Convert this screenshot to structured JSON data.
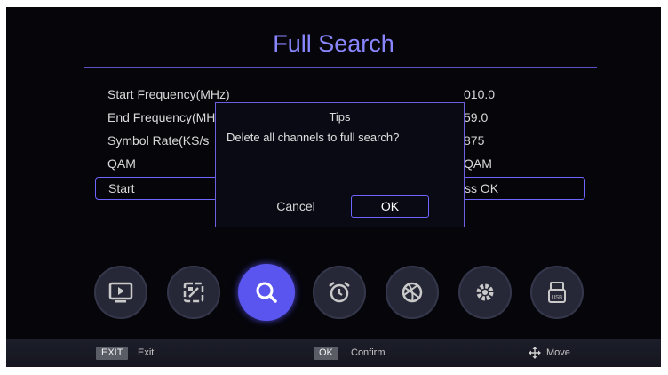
{
  "title": "Full Search",
  "rows": [
    {
      "label": "Start Frequency(MHz)",
      "value": "010.0"
    },
    {
      "label": "End Frequency(MH",
      "value": "59.0"
    },
    {
      "label": "Symbol Rate(KS/s",
      "value": "875"
    },
    {
      "label": "QAM",
      "value": "QAM"
    },
    {
      "label": "Start",
      "value": "ss OK"
    }
  ],
  "dialog": {
    "title": "Tips",
    "message": "Delete all channels to full search?",
    "cancel": "Cancel",
    "ok": "OK"
  },
  "menu_icons": [
    "tv-icon",
    "picture-icon",
    "search-icon",
    "alarm-clock-icon",
    "globe-icon",
    "gear-icon",
    "usb-icon"
  ],
  "menu_active": "search-icon",
  "bottom_bar": {
    "exit_key": "EXIT",
    "exit_label": "Exit",
    "ok_key": "OK",
    "ok_label": "Confirm",
    "move_label": "Move"
  },
  "colors": {
    "accent": "#6e64ff",
    "active_icon": "#5b55f0",
    "background": "#05050a"
  }
}
